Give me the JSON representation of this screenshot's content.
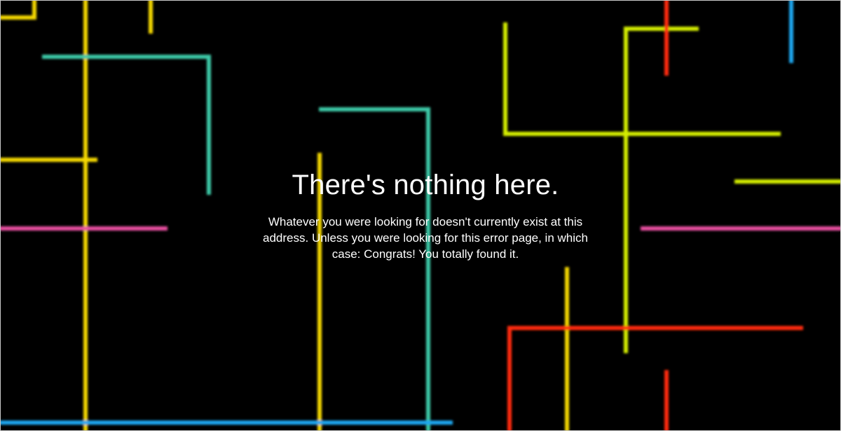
{
  "error_page": {
    "title": "There's nothing here.",
    "message": "Whatever you were looking for doesn't currently exist at this address. Unless you were looking for this error page, in which case: Congrats! You totally found it."
  },
  "background": {
    "color": "#000000",
    "line_colors": {
      "yellow": "#f5d800",
      "lime": "#d4ee00",
      "teal": "#3ec9a7",
      "pink": "#e84fa0",
      "red": "#ff2a10",
      "blue": "#1ea7f0"
    }
  }
}
